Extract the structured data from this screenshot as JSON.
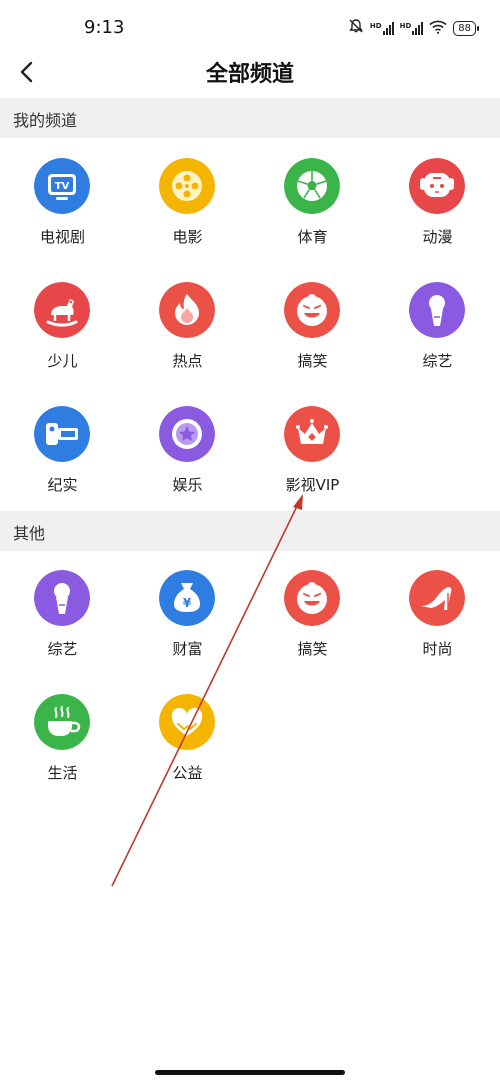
{
  "status": {
    "time": "9:13",
    "battery": "88"
  },
  "header": {
    "title": "全部频道"
  },
  "sections": {
    "mine": {
      "title": "我的频道",
      "items": [
        {
          "label": "电视剧",
          "icon": "tv-icon",
          "color": "#2f7de1"
        },
        {
          "label": "电影",
          "icon": "film-reel-icon",
          "color": "#f5b400"
        },
        {
          "label": "体育",
          "icon": "soccer-ball-icon",
          "color": "#3bb54a"
        },
        {
          "label": "动漫",
          "icon": "anime-character-icon",
          "color": "#e8474a"
        },
        {
          "label": "少儿",
          "icon": "rocking-horse-icon",
          "color": "#e8474a"
        },
        {
          "label": "热点",
          "icon": "flame-icon",
          "color": "#ec5148"
        },
        {
          "label": "搞笑",
          "icon": "laughing-face-icon",
          "color": "#ec5148"
        },
        {
          "label": "综艺",
          "icon": "microphone-icon",
          "color": "#8a5ae0"
        },
        {
          "label": "纪实",
          "icon": "camera-icon",
          "color": "#2f7de1"
        },
        {
          "label": "娱乐",
          "icon": "star-badge-icon",
          "color": "#8a5ae0"
        },
        {
          "label": "影视VIP",
          "icon": "crown-icon",
          "color": "#ec5148"
        }
      ]
    },
    "other": {
      "title": "其他",
      "items": [
        {
          "label": "综艺",
          "icon": "microphone-icon",
          "color": "#8a5ae0"
        },
        {
          "label": "财富",
          "icon": "money-bag-icon",
          "color": "#2f7de1"
        },
        {
          "label": "搞笑",
          "icon": "laughing-face-icon",
          "color": "#ec5148"
        },
        {
          "label": "时尚",
          "icon": "high-heel-icon",
          "color": "#ec5148"
        },
        {
          "label": "生活",
          "icon": "coffee-cup-icon",
          "color": "#3bb54a"
        },
        {
          "label": "公益",
          "icon": "heart-hands-icon",
          "color": "#f5b400"
        }
      ]
    }
  }
}
